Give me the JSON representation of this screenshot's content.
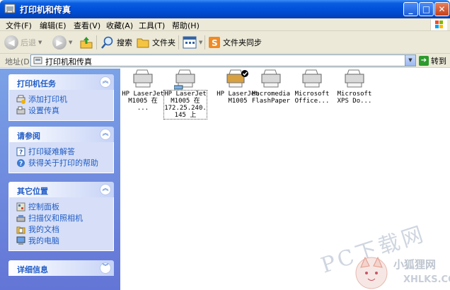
{
  "window": {
    "title": "打印机和传真"
  },
  "menubar": {
    "items": [
      "文件(F)",
      "编辑(E)",
      "查看(V)",
      "收藏(A)",
      "工具(T)",
      "帮助(H)"
    ]
  },
  "toolbar": {
    "back_label": "后退",
    "search_label": "搜索",
    "folders_label": "文件夹",
    "sync_label": "文件夹同步"
  },
  "address": {
    "label": "地址(D)",
    "value": "打印机和传真",
    "go_label": "转到"
  },
  "sidebar": {
    "panels": [
      {
        "title": "打印机任务",
        "links": [
          "添加打印机",
          "设置传真"
        ]
      },
      {
        "title": "请参阅",
        "links": [
          "打印疑难解答",
          "获得关于打印的帮助"
        ]
      },
      {
        "title": "其它位置",
        "links": [
          "控制面板",
          "扫描仪和照相机",
          "我的文档",
          "我的电脑"
        ]
      },
      {
        "title": "详细信息",
        "links": []
      }
    ]
  },
  "printers": [
    {
      "line1": "HP LaserJet",
      "line2": "M1005 在 ...",
      "line3": "",
      "line4": ""
    },
    {
      "line1": "HP LaserJet",
      "line2": "M1005 在",
      "line3": "172.25.240.",
      "line4": "145 上"
    },
    {
      "line1": "HP LaserJet",
      "line2": "M1005",
      "line3": "",
      "line4": ""
    },
    {
      "line1": "Macromedia",
      "line2": "FlashPaper",
      "line3": "",
      "line4": ""
    },
    {
      "line1": "Microsoft",
      "line2": "Office...",
      "line3": "",
      "line4": ""
    },
    {
      "line1": "Microsoft",
      "line2": "XPS Do...",
      "line3": "",
      "line4": ""
    }
  ],
  "watermark": {
    "big": "PC下载网",
    "small": "小狐狸网",
    "url": "XHLKS.COM"
  },
  "colors": {
    "title_blue": "#0050d8",
    "link_blue": "#215dc6",
    "pane_blue": "#7ba2e7"
  }
}
